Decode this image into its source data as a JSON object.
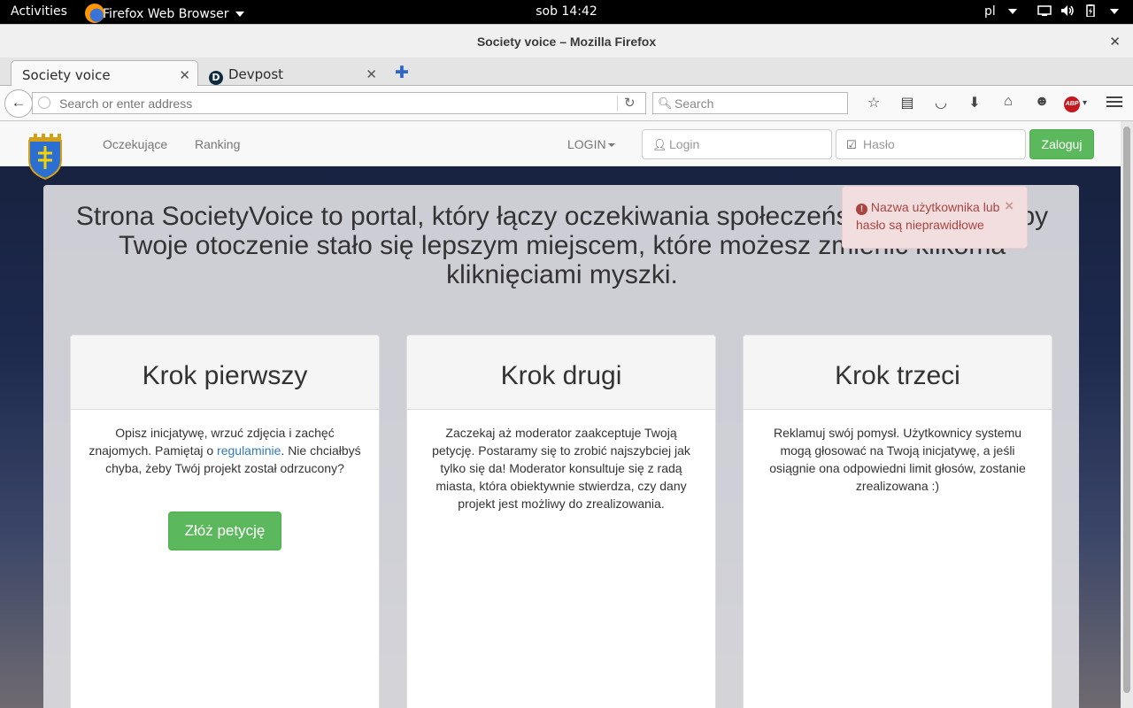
{
  "os": {
    "activities": "Activities",
    "app_name": "Firefox Web Browser",
    "clock": "sob 14:42",
    "lang": "pl"
  },
  "window": {
    "title": "Society voice – Mozilla Firefox"
  },
  "tabs": [
    {
      "label": "Society voice",
      "active": true
    },
    {
      "label": "Devpost",
      "active": false,
      "favicon": "D"
    }
  ],
  "navbar": {
    "url_placeholder": "Search or enter address",
    "search_placeholder": "Search"
  },
  "site": {
    "nav": {
      "links": [
        "Oczekujące",
        "Ranking"
      ],
      "login_dropdown": "LOGIN",
      "login_placeholder": "Login",
      "password_placeholder": "Hasło",
      "submit": "Zaloguj"
    },
    "alert": {
      "message": "Nazwa użytkownika lub hasło są nieprawidłowe",
      "close": "×"
    },
    "headline": "Strona SocietyVoice to portal, który łączy oczekiwania społeczeństwa i władzy, aby Twoje otoczenie stało się lepszym miejscem, które możesz zmienić kilkoma kliknięciami myszki.",
    "steps": [
      {
        "title": "Krok pierwszy",
        "text_before": "Opisz inicjatywę, wrzuć zdjęcia i zachęć znajomych. Pamiętaj o ",
        "link": "regulaminie",
        "text_after": ". Nie chciałbyś chyba, żeby Twój projekt został odrzucony?",
        "button": "Złóż petycję"
      },
      {
        "title": "Krok drugi",
        "text": "Zaczekaj aż moderator zaakceptuje Twoją petycję. Postaramy się to zrobić najszybciej jak tylko się da! Moderator konsultuje się z radą miasta, która obiektywnie stwierdza, czy dany projekt jest możliwy do zrealizowania."
      },
      {
        "title": "Krok trzeci",
        "text": "Reklamuj swój pomysł. Użytkownicy systemu mogą głosować na Twoją inicjatywę, a jeśli osiągnie ona odpowiedni limit głosów, zostanie zrealizowana :)"
      }
    ]
  },
  "colors": {
    "success": "#5cb85c",
    "alert_bg": "#f2dede",
    "alert_text": "#a94442",
    "link": "#337ab7"
  }
}
